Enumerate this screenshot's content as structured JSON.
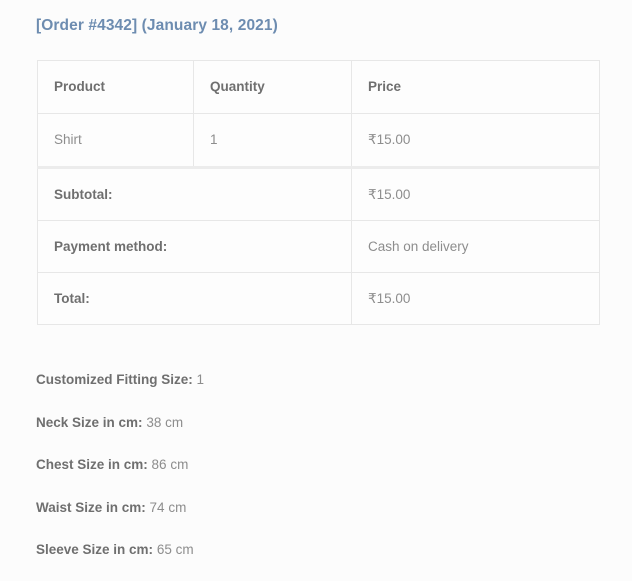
{
  "order": {
    "heading": "[Order #4342] (January 18, 2021)",
    "order_number": "#4342",
    "date": "January 18, 2021"
  },
  "table": {
    "columns": [
      {
        "key": "product",
        "label": "Product"
      },
      {
        "key": "quantity",
        "label": "Quantity"
      },
      {
        "key": "price",
        "label": "Price"
      }
    ],
    "rows": [
      {
        "product": "Shirt",
        "quantity": "1",
        "price": "₹15.00"
      }
    ],
    "footer": [
      {
        "label": "Subtotal:",
        "value": "₹15.00"
      },
      {
        "label": "Payment method:",
        "value": "Cash on delivery"
      },
      {
        "label": "Total:",
        "value": "₹15.00"
      }
    ]
  },
  "attributes": [
    {
      "label": "Customized Fitting Size:",
      "value": "1"
    },
    {
      "label": "Neck Size in cm:",
      "value": "38 cm"
    },
    {
      "label": "Chest Size in cm:",
      "value": "86 cm"
    },
    {
      "label": "Waist Size in cm:",
      "value": "74 cm"
    },
    {
      "label": "Sleeve Size in cm:",
      "value": "65 cm"
    }
  ],
  "colors": {
    "heading": "#6d8cb0",
    "label_text": "#6f6f6f",
    "value_text": "#8d8d8d",
    "border": "#e7e7e7",
    "background": "#fcfcfc"
  }
}
